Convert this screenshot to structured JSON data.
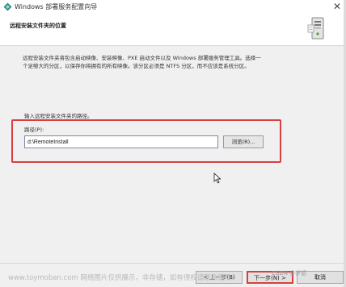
{
  "window": {
    "title": "Windows 部署服务配置向导",
    "close_glyph": "✕"
  },
  "header": {
    "title": "远程安装文件夹的位置"
  },
  "description": "远程安装文件夹将包含启动映像、安装映像、PXE 启动文件以及 Windows 部署服务管理工具。选择一个足够大的分区，以保存你将拥有的所有映像。该分区必须是 NTFS 分区，而不应该是系统分区。",
  "path_prompt": "输入远程安装文件夹的路径。",
  "path": {
    "label": "路径(P):",
    "value": "d:\\RemoteInstall",
    "browse_label": "浏览(R)..."
  },
  "buttons": {
    "prev": "< 上一步(B)",
    "next": "下一步(N) >",
    "cancel": "取消"
  },
  "overlay": {
    "watermark": "www.toymoban.com 网络图片仅供展示，非存储，如有侵权请联系删除。",
    "csdn": "CSDN @梦想"
  },
  "colors": {
    "highlight": "#d8403f",
    "dialog_bg": "#f0f0f0"
  },
  "icons": {
    "title": "wds-app-icon",
    "header": "server-icon",
    "pointer": "mouse-cursor-icon"
  }
}
